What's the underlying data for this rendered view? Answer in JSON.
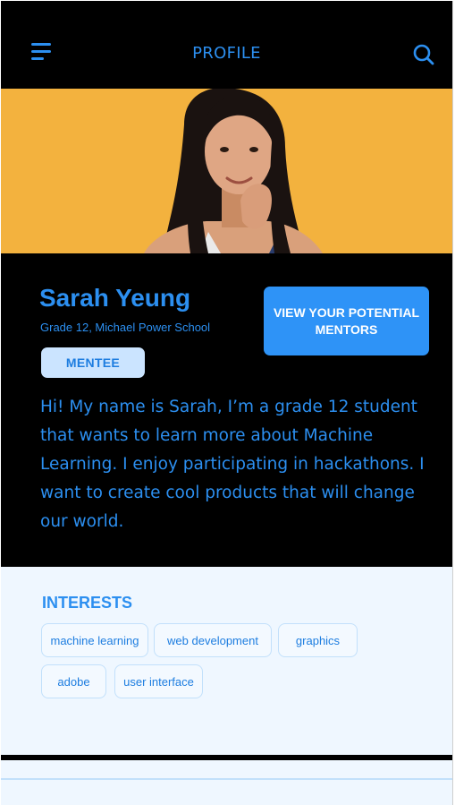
{
  "header": {
    "title": "PROFILE",
    "menu_icon": "menu-icon",
    "search_icon": "search-icon"
  },
  "colors": {
    "accent": "#2C8FF0",
    "button": "#2E93F7",
    "badge_bg": "#CBE4FF",
    "page_bg": "#000000",
    "interests_bg": "#EFF7FF",
    "hero_bg": "#F3B23E"
  },
  "profile": {
    "name": "Sarah Yeung",
    "school": "Grade 12, Michael Power School",
    "role": "MENTEE",
    "cta_label": "VIEW YOUR POTENTIAL MENTORS",
    "bio": "Hi! My name is Sarah, I’m a grade 12 student that wants to learn more about Machine Learning. I enjoy participating in hackathons. I want to create cool products that will change our world."
  },
  "interests": {
    "title": "INTERESTS",
    "tags": [
      "machine learning",
      "web development",
      "graphics",
      "adobe",
      "user interface"
    ]
  }
}
